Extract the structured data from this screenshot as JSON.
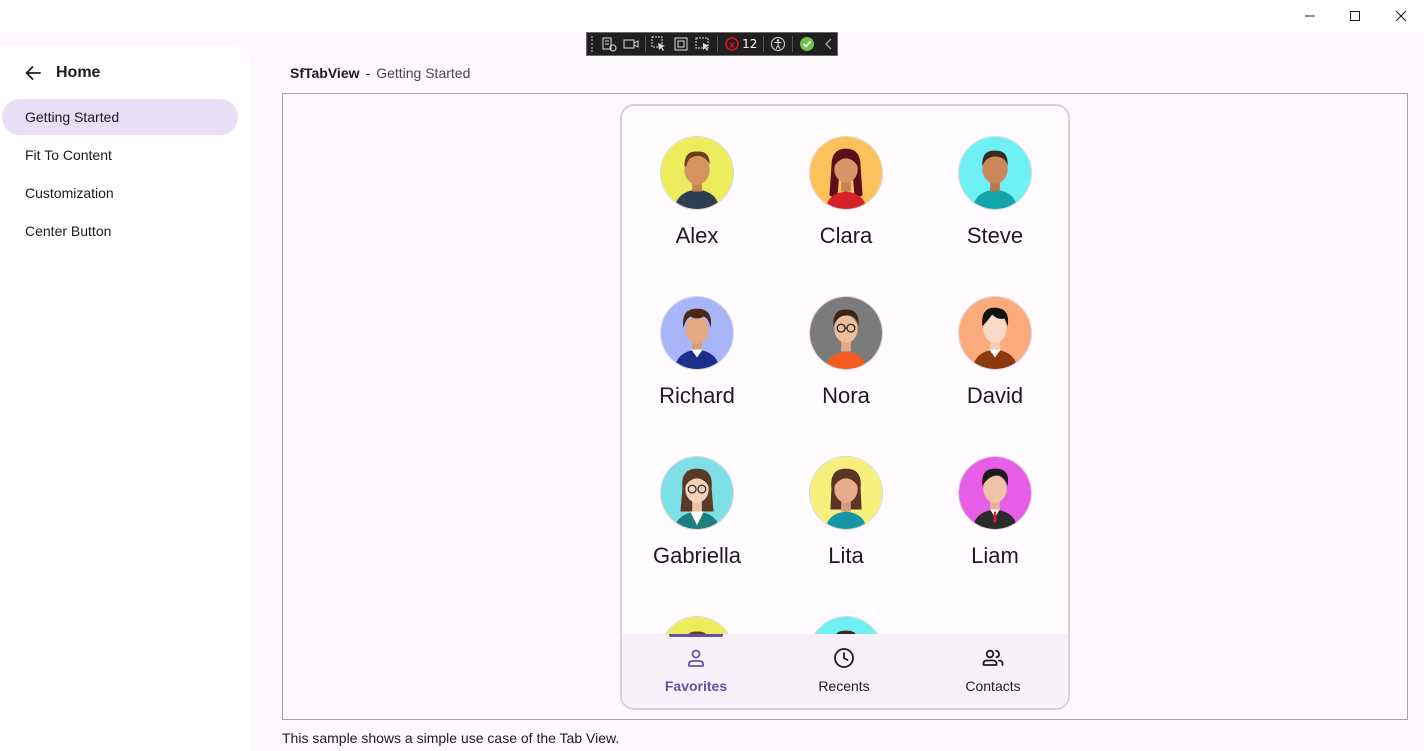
{
  "window": {
    "controls": [
      "minimize-icon",
      "maximize-icon",
      "close-icon"
    ]
  },
  "devbar": {
    "binding_error_count": "12",
    "accent_color": "#6cc24a"
  },
  "sidebar": {
    "back_label": "Home",
    "items": [
      {
        "label": "Getting Started",
        "active": true
      },
      {
        "label": "Fit To Content",
        "active": false
      },
      {
        "label": "Customization",
        "active": false
      },
      {
        "label": "Center Button",
        "active": false
      }
    ]
  },
  "header": {
    "control": "SfTabView",
    "separator": "-",
    "page": "Getting Started"
  },
  "contacts": [
    {
      "name": "Alex",
      "bg": "#ecec5c"
    },
    {
      "name": "Clara",
      "bg": "#fcc15a"
    },
    {
      "name": "Steve",
      "bg": "#6ff0f4"
    },
    {
      "name": "Richard",
      "bg": "#a8b5fa"
    },
    {
      "name": "Nora",
      "bg": "#7b7b7b"
    },
    {
      "name": "David",
      "bg": "#fbaa7c"
    },
    {
      "name": "Gabriella",
      "bg": "#7ee0e6"
    },
    {
      "name": "Lita",
      "bg": "#f7ef7c"
    },
    {
      "name": "Liam",
      "bg": "#e65ee8"
    },
    {
      "name": "",
      "bg": "#ecec5c"
    },
    {
      "name": "",
      "bg": "#6ff0f4"
    }
  ],
  "tabs": [
    {
      "label": "Favorites",
      "icon": "person-icon",
      "selected": true
    },
    {
      "label": "Recents",
      "icon": "clock-icon",
      "selected": false
    },
    {
      "label": "Contacts",
      "icon": "people-icon",
      "selected": false
    }
  ],
  "theme": {
    "primary": "#6750a4",
    "selected_nav": "#e8def8",
    "tabbar_bg": "#f7f2fa"
  },
  "description": "This sample shows a simple use case of the Tab View."
}
